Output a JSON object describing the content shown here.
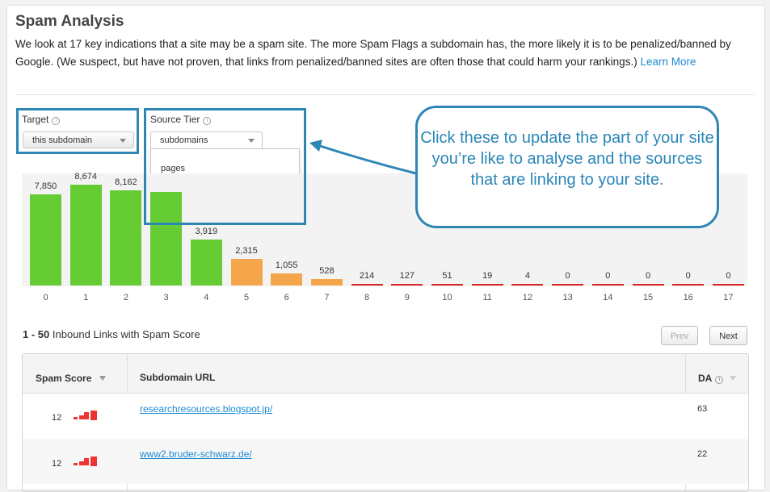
{
  "header": {
    "title": "Spam Analysis",
    "description": "We look at 17 key indications that a site may be a spam site. The more Spam Flags a subdomain has, the more likely it is to be penalized/banned by Google. (We suspect, but have not proven, that links from penalized/banned sites are often those that could harm your rankings.)",
    "learn_more": "Learn More"
  },
  "controls": {
    "target": {
      "label": "Target",
      "value": "this subdomain"
    },
    "source_tier": {
      "label": "Source Tier",
      "value": "subdomains",
      "options": [
        "pages",
        "subdomains"
      ]
    }
  },
  "callout": "Click these to update the part of your site you’re like to analyse and the sources that are linking to your site.",
  "chart_data": {
    "type": "bar",
    "categories": [
      "0",
      "1",
      "2",
      "3",
      "4",
      "5",
      "6",
      "7",
      "8",
      "9",
      "10",
      "11",
      "12",
      "13",
      "14",
      "15",
      "16",
      "17"
    ],
    "values": [
      7850,
      8674,
      8162,
      null,
      3919,
      2315,
      1055,
      528,
      214,
      127,
      51,
      19,
      4,
      0,
      0,
      0,
      0,
      0
    ],
    "value_labels": [
      "7,850",
      "8,674",
      "8,162",
      "",
      "3,919",
      "2,315",
      "1,055",
      "528",
      "214",
      "127",
      "51",
      "19",
      "4",
      "0",
      "0",
      "0",
      "0",
      "0"
    ],
    "colors": {
      "low": "#66cc33",
      "medium": "#f5a64a",
      "high": "#dd2222"
    }
  },
  "links": {
    "range": "1 - 50",
    "title": "Inbound Links with Spam Score",
    "prev_label": "Prev",
    "next_label": "Next",
    "columns": {
      "spam_score": "Spam Score",
      "url": "Subdomain URL",
      "da": "DA"
    },
    "rows": [
      {
        "spam_score": "12",
        "url": "researchresources.blogspot.jp/",
        "da": "63"
      },
      {
        "spam_score": "12",
        "url": "www2.bruder-schwarz.de/",
        "da": "22"
      }
    ]
  }
}
